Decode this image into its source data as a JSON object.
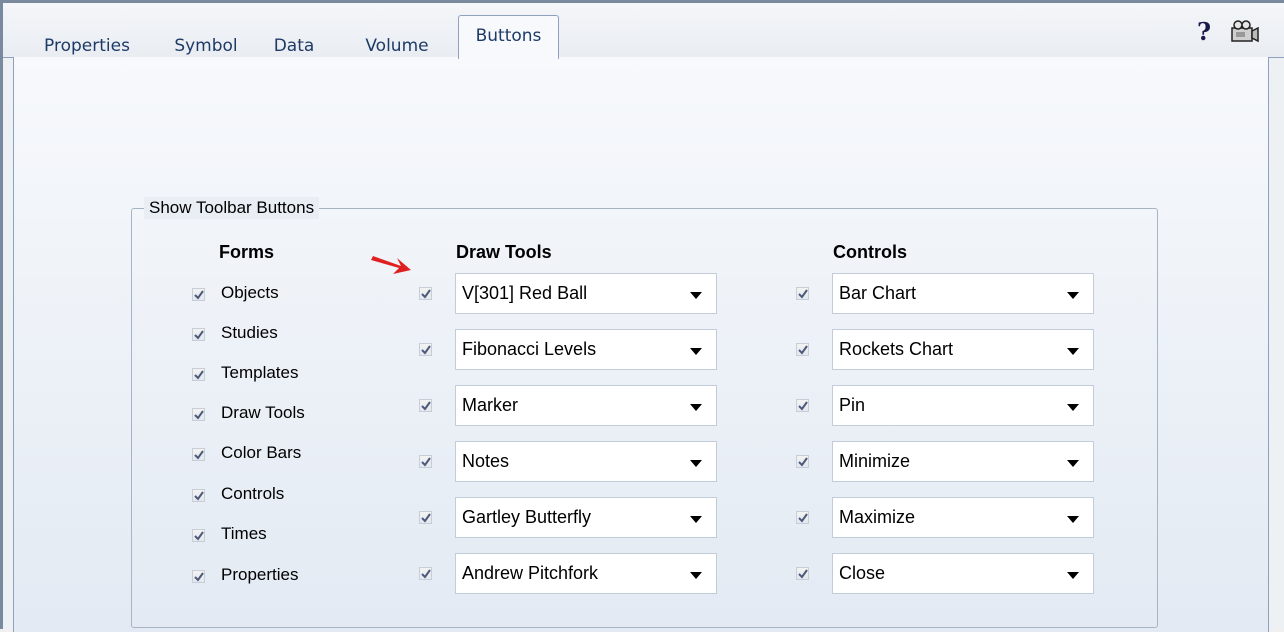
{
  "tabs": [
    {
      "label": "Properties"
    },
    {
      "label": "Symbol"
    },
    {
      "label": "Data"
    },
    {
      "label": "Volume"
    },
    {
      "label": "Buttons",
      "active": true
    }
  ],
  "toolbar": {
    "help_label": "?",
    "camera_icon": "camera-icon"
  },
  "group": {
    "title": "Show Toolbar Buttons"
  },
  "forms": {
    "header": "Forms",
    "items": [
      {
        "label": "Objects",
        "checked": true
      },
      {
        "label": "Studies",
        "checked": true
      },
      {
        "label": "Templates",
        "checked": true
      },
      {
        "label": "Draw Tools",
        "checked": true
      },
      {
        "label": "Color Bars",
        "checked": true
      },
      {
        "label": "Controls",
        "checked": true
      },
      {
        "label": "Times",
        "checked": true
      },
      {
        "label": "Properties",
        "checked": true
      }
    ]
  },
  "draw_tools": {
    "header": "Draw Tools",
    "items": [
      {
        "value": "V[301]  Red Ball",
        "checked": true
      },
      {
        "value": "Fibonacci Levels",
        "checked": true
      },
      {
        "value": "Marker",
        "checked": true
      },
      {
        "value": "Notes",
        "checked": true
      },
      {
        "value": "Gartley Butterfly",
        "checked": true
      },
      {
        "value": "Andrew Pitchfork",
        "checked": true
      }
    ]
  },
  "controls": {
    "header": "Controls",
    "items": [
      {
        "value": "Bar Chart",
        "checked": true
      },
      {
        "value": "Rockets Chart",
        "checked": true
      },
      {
        "value": "Pin",
        "checked": true
      },
      {
        "value": "Minimize",
        "checked": true
      },
      {
        "value": "Maximize",
        "checked": true
      },
      {
        "value": "Close",
        "checked": true
      }
    ]
  },
  "colors": {
    "annotation_arrow": "#e02020",
    "tab_text": "#1e3a66",
    "checkmark": "#4a5a78"
  }
}
